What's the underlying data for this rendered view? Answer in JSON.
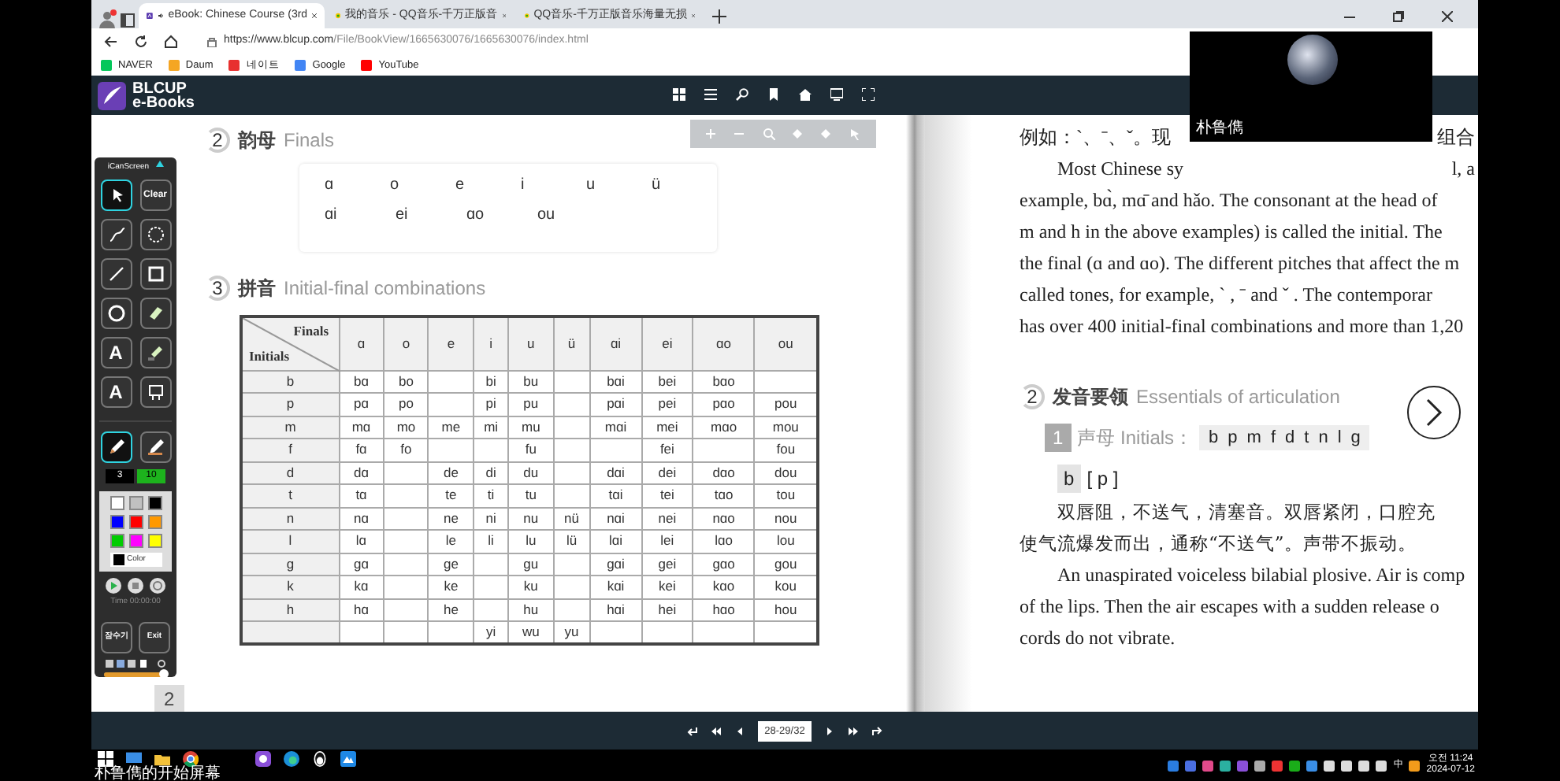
{
  "browser": {
    "tabs": [
      {
        "title": "eBook: Chinese Course (3rd",
        "selected": true,
        "audio": true
      },
      {
        "title": "我的音乐 - QQ音乐-千万正版音",
        "selected": false,
        "audio": false
      },
      {
        "title": "QQ音乐-千万正版音乐海量无损",
        "selected": false,
        "audio": false
      }
    ],
    "url_host": "https://www.blcup.com",
    "url_path": "/File/BookView/1665630076/1665630076/index.html",
    "bookmarks": [
      {
        "label": "NAVER",
        "color": "#03c75a"
      },
      {
        "label": "Daum",
        "color": "#f5a623"
      },
      {
        "label": "네이트",
        "color": "#e8302f"
      },
      {
        "label": "Google",
        "color": "#4285f4"
      },
      {
        "label": "YouTube",
        "color": "#ff0000"
      }
    ]
  },
  "reader": {
    "logo": [
      "BLCUP",
      "e-Books"
    ]
  },
  "left_page": {
    "finals_heading": {
      "number": "2",
      "zh": "韵母",
      "en": "Finals"
    },
    "finals": [
      [
        "ɑ",
        "o",
        "e",
        "i",
        "u",
        "ü"
      ],
      [
        "ɑi",
        "ei",
        "ɑo",
        "ou"
      ]
    ],
    "table_heading": {
      "number": "3",
      "zh": "拼音",
      "en": "Initial-final combinations"
    },
    "table": {
      "corner_top": "Finals",
      "corner_bottom": "Initials",
      "columns": [
        "ɑ",
        "o",
        "e",
        "i",
        "u",
        "ü",
        "ɑi",
        "ei",
        "ɑo",
        "ou"
      ],
      "rows": [
        {
          "initial": "b",
          "cells": [
            "bɑ",
            "bo",
            "",
            "bi",
            "bu",
            "",
            "bɑi",
            "bei",
            "bɑo",
            ""
          ]
        },
        {
          "initial": "p",
          "cells": [
            "pɑ",
            "po",
            "",
            "pi",
            "pu",
            "",
            "pɑi",
            "pei",
            "pɑo",
            "pou"
          ]
        },
        {
          "initial": "m",
          "cells": [
            "mɑ",
            "mo",
            "me",
            "mi",
            "mu",
            "",
            "mɑi",
            "mei",
            "mɑo",
            "mou"
          ]
        },
        {
          "initial": "f",
          "cells": [
            "fɑ",
            "fo",
            "",
            "",
            "fu",
            "",
            "",
            "fei",
            "",
            "fou"
          ]
        },
        {
          "initial": "d",
          "cells": [
            "dɑ",
            "",
            "de",
            "di",
            "du",
            "",
            "dɑi",
            "dei",
            "dɑo",
            "dou"
          ]
        },
        {
          "initial": "t",
          "cells": [
            "tɑ",
            "",
            "te",
            "ti",
            "tu",
            "",
            "tɑi",
            "tei",
            "tɑo",
            "tou"
          ]
        },
        {
          "initial": "n",
          "cells": [
            "nɑ",
            "",
            "ne",
            "ni",
            "nu",
            "nü",
            "nɑi",
            "nei",
            "nɑo",
            "nou"
          ]
        },
        {
          "initial": "l",
          "cells": [
            "lɑ",
            "",
            "le",
            "li",
            "lu",
            "lü",
            "lɑi",
            "lei",
            "lɑo",
            "lou"
          ]
        },
        {
          "initial": "g",
          "cells": [
            "gɑ",
            "",
            "ge",
            "",
            "gu",
            "",
            "gɑi",
            "gei",
            "gɑo",
            "gou"
          ]
        },
        {
          "initial": "k",
          "cells": [
            "kɑ",
            "",
            "ke",
            "",
            "ku",
            "",
            "kɑi",
            "kei",
            "kɑo",
            "kou"
          ]
        },
        {
          "initial": "h",
          "cells": [
            "hɑ",
            "",
            "he",
            "",
            "hu",
            "",
            "hɑi",
            "hei",
            "hɑo",
            "hou"
          ]
        },
        {
          "initial": "",
          "cells": [
            "",
            "",
            "",
            "yi",
            "wu",
            "yu",
            "",
            "",
            "",
            ""
          ]
        }
      ]
    },
    "page_number": "2"
  },
  "right_page": {
    "intro_zh": {
      "left": "例如：ˋ、ˉ、ˇ。现",
      "right": "组合"
    },
    "intro_first": {
      "left": "Most Chinese sy",
      "right": "l, a"
    },
    "intro_lines": [
      "example, bɑ̀, mɑ̄ and hǎo. The consonant at the head of",
      "m and h in the above examples) is called the initial. The",
      "the final (ɑ and ɑo). The different pitches that affect the m",
      "called tones, for example, ˋ , ˉ and ˇ . The contemporar",
      "has over 400 initial-final combinations and more than 1,20"
    ],
    "heading": {
      "number": "2",
      "zh": "发音要领",
      "en": "Essentials of articulation"
    },
    "initials_row": {
      "number": "1",
      "label": "声母 Initials：",
      "letters": [
        "b",
        "p",
        "m",
        "f",
        "d",
        "t",
        "n",
        "l",
        "g"
      ]
    },
    "sound": {
      "letter": "b",
      "ipa": "[ p ]"
    },
    "zh_lines": [
      "双唇阻，不送气，清塞音。双唇紧闭，口腔充",
      "使气流爆发而出，通称“不送气”。声带不振动。"
    ],
    "en_lines": [
      "An unaspirated voiceless bilabial plosive. Air is comp",
      "of the lips. Then the air escapes with a sudden release o",
      "cords do not vibrate."
    ]
  },
  "tool_panel": {
    "title": "iCanScreen",
    "tools": [
      {
        "kind": "pointer",
        "selected": true
      },
      {
        "kind": "clear",
        "label": "Clear",
        "selected": false
      },
      {
        "kind": "curve",
        "selected": false
      },
      {
        "kind": "dashed-circle",
        "selected": false
      },
      {
        "kind": "line",
        "selected": false
      },
      {
        "kind": "rectangle",
        "selected": false
      },
      {
        "kind": "ellipse",
        "selected": false
      },
      {
        "kind": "eraser",
        "selected": false
      },
      {
        "kind": "text",
        "label": "A",
        "selected": false
      },
      {
        "kind": "highlighter",
        "selected": false
      },
      {
        "kind": "stamp",
        "label": "A",
        "selected": false
      },
      {
        "kind": "board",
        "selected": false
      },
      {
        "kind": "pen",
        "selected": true
      },
      {
        "kind": "marker",
        "selected": false
      }
    ],
    "pen_size": "3",
    "marker_size": "10",
    "colors": [
      {
        "color": "#ffffff"
      },
      {
        "color": "#c0c0c0"
      },
      {
        "color": "#000000"
      },
      {
        "color": "#0000ff"
      },
      {
        "color": "#ff0000"
      },
      {
        "color": "#ff9900"
      },
      {
        "color": "#00cc00"
      },
      {
        "color": "#ff00ff"
      },
      {
        "color": "#ffff00"
      }
    ],
    "current": {
      "color": "#000000"
    },
    "color_label": "Color",
    "time": "Time 00:00:00",
    "opacity": {
      "level": 0.95
    },
    "buttons": [
      "잠수기",
      "Exit"
    ]
  },
  "pager": {
    "page": "28-29/32"
  },
  "video_call": {
    "name": "朴鲁儁"
  },
  "taskbar": {
    "start_caption": "朴鲁儁的开始屏幕",
    "ime": "中",
    "time": "오전 11:24",
    "date": "2024-07-12"
  }
}
